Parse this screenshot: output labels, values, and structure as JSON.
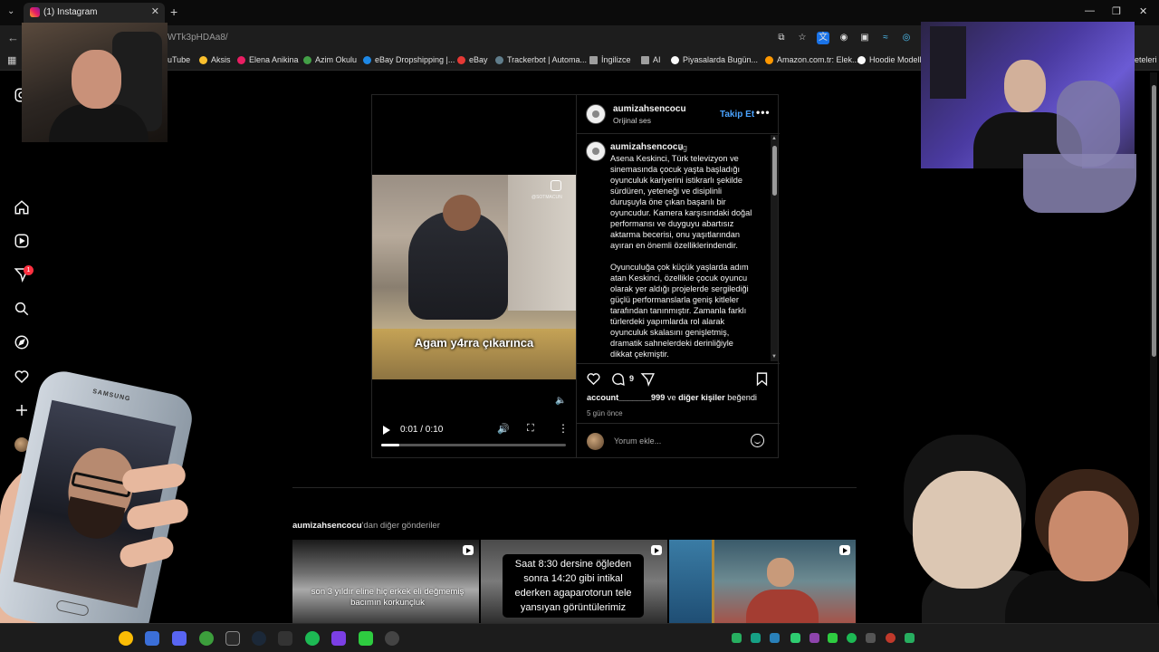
{
  "browser": {
    "tab_title": "(1) Instagram",
    "tab_close": "✕",
    "new_tab": "+",
    "tab_menu": "⌄",
    "window_controls": [
      "—",
      "❐",
      "✕"
    ],
    "back": "←",
    "url": "WTk3pHDAa8/",
    "extensions": [
      "⧉",
      "☆",
      "文",
      "◉",
      "▣",
      "≈",
      "◎"
    ],
    "bookmarks_apps": "▦",
    "bookmarks": [
      {
        "label": "uTube",
        "color": "#e53935"
      },
      {
        "label": "Aksis",
        "color": "#fbc02d"
      },
      {
        "label": "Elena Anikina",
        "color": "#e91e63"
      },
      {
        "label": "Azim Okulu",
        "color": "#43a047"
      },
      {
        "label": "eBay Dropshipping |...",
        "color": "#1e88e5"
      },
      {
        "label": "eBay",
        "color": "#e53935"
      },
      {
        "label": "Trackerbot | Automa...",
        "color": "#607d8b"
      },
      {
        "label": "İngilizce",
        "color": "#9e9e9e"
      },
      {
        "label": "AI",
        "color": "#9e9e9e"
      },
      {
        "label": "Piyasalarda Bugün...",
        "color": "#fafafa"
      },
      {
        "label": "Amazon.com.tr: Elek...",
        "color": "#ff9800"
      },
      {
        "label": "Hoodie Modelle",
        "color": "#fafafa"
      },
      {
        "label": "eteleri",
        "color": "#9e9e9e"
      }
    ]
  },
  "sidebar": {
    "icons": [
      "instagram-icon",
      "home-icon",
      "reels-icon",
      "messages-icon",
      "search-icon",
      "explore-icon",
      "notifications-icon",
      "create-icon",
      "profile-avatar"
    ],
    "messages_badge": "1"
  },
  "post": {
    "username": "aumizahsencocu",
    "audio": "Orijinal ses",
    "follow": "Takip Et",
    "more": "•••",
    "caption_user": "aumizahsencocu",
    "caption_time": "5g",
    "caption_p1": "Asena Keskinci, Türk televizyon ve sinemasında çocuk yaşta başladığı oyunculuk kariyerini istikrarlı şekilde sürdüren, yeteneği ve disiplinli duruşuyla öne çıkan başarılı bir oyuncudur. Kamera karşısındaki doğal performansı ve duyguyu abartısız aktarma becerisi, onu yaşıtlarından ayıran en önemli özelliklerindendir.",
    "caption_p2": "Oyunculuğa çok küçük yaşlarda adım atan Keskinci, özellikle çocuk oyuncu olarak yer aldığı projelerde sergilediği güçlü performanslarla geniş kitleler tarafından tanınmıştır. Zamanla farklı türlerdeki yapımlarda rol alarak oyunculuk skalasını genişletmiş, dramatik sahnelerdeki derinliğiyle dikkat çekmiştir.",
    "comment_count": "9",
    "liked_by_user": "account_______999",
    "liked_by_mid": " ve ",
    "liked_by_others": "diğer kişiler",
    "liked_by_end": " beğendi",
    "posted_ago": "5 gün önce",
    "comment_placeholder": "Yorum ekle...",
    "video": {
      "caption": "Agam y4rra çıkarınca",
      "watermark": "@SOTMACUN",
      "time": "0:01 / 0:10",
      "progress": 0.1
    }
  },
  "more_posts": {
    "user": "aumizahsencocu",
    "suffix": "'dan diğer gönderiler",
    "thumbs": [
      {
        "text": "son 3 yıldır eline hiç erkek eli değmemiş bacımın korkunçluk"
      },
      {
        "text": "Saat 8:30 dersine öğleden sonra 14:20 gibi intikal ederken agaparotorun tele yansıyan görüntülerimiz"
      },
      {
        "text": ""
      }
    ]
  },
  "overlays": {
    "phone_brand": "SAMSUNG"
  },
  "taskbar": {
    "apps": [
      {
        "name": "chrome",
        "color": "#fbbc05"
      },
      {
        "name": "app-blue",
        "color": "#3b6fd8"
      },
      {
        "name": "discord",
        "color": "#5865f2"
      },
      {
        "name": "xbox",
        "color": "#3c9e3c"
      },
      {
        "name": "epic",
        "color": "#2a2a2a"
      },
      {
        "name": "steam",
        "color": "#1b2838"
      },
      {
        "name": "app-dark",
        "color": "#333"
      },
      {
        "name": "spotify",
        "color": "#1db954"
      },
      {
        "name": "app-purple",
        "color": "#7b3fe4"
      },
      {
        "name": "app-green",
        "color": "#2ecc40"
      },
      {
        "name": "obs",
        "color": "#444"
      }
    ],
    "tray": [
      "#27ae60",
      "#16a085",
      "#2980b9",
      "#2ecc71",
      "#8e44ad",
      "#7b3fe4",
      "#2ecc40",
      "#1db954",
      "#555",
      "#c0392b",
      "#27ae60",
      "#3498db"
    ]
  }
}
